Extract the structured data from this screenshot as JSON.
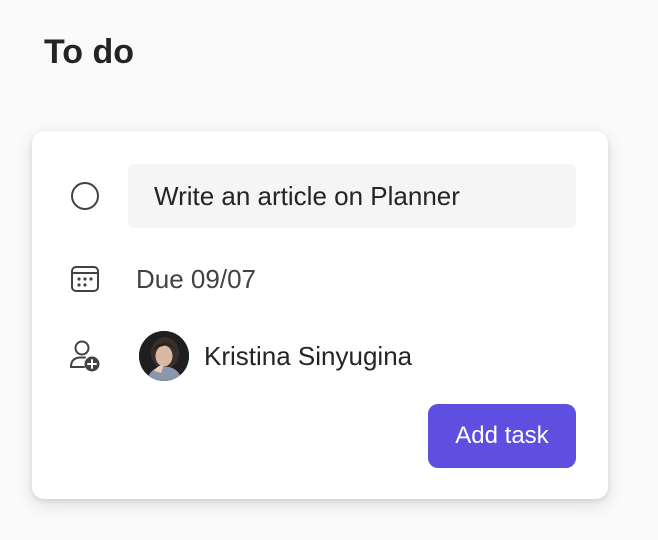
{
  "column": {
    "title": "To do"
  },
  "task_card": {
    "title_value": "Write an article on Planner",
    "due_label": "Due 09/07",
    "assignee_name": "Kristina Sinyugina",
    "add_button_label": "Add task"
  },
  "icons": {
    "complete": "circle-icon",
    "due_date": "calendar-icon",
    "assign": "person-add-icon",
    "avatar": "avatar"
  },
  "colors": {
    "accent": "#5e4fe0",
    "input_bg": "#f5f5f5",
    "card_bg": "#ffffff"
  }
}
